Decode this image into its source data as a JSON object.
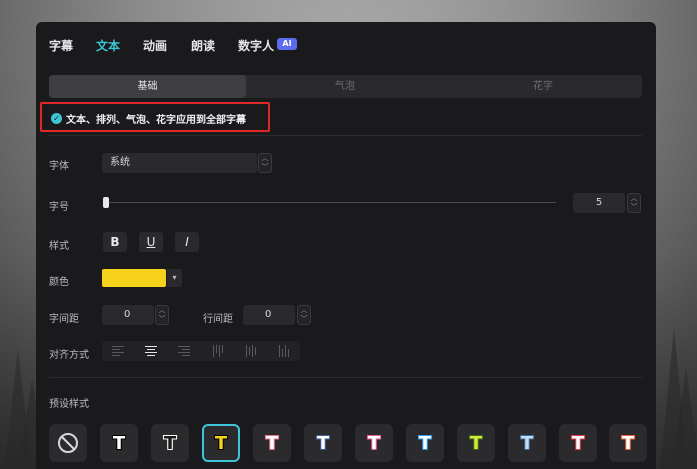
{
  "tabs": [
    {
      "label": "字幕",
      "active": false
    },
    {
      "label": "文本",
      "active": true
    },
    {
      "label": "动画",
      "active": false
    },
    {
      "label": "朗读",
      "active": false
    },
    {
      "label": "数字人",
      "active": false
    }
  ],
  "ai_badge": "AI",
  "subtabs": [
    {
      "label": "基础",
      "active": true
    },
    {
      "label": "气泡",
      "active": false
    },
    {
      "label": "花字",
      "active": false
    }
  ],
  "apply_all": {
    "checked": true,
    "label": "文本、排列、气泡、花字应用到全部字幕"
  },
  "font": {
    "label": "字体",
    "value": "系统"
  },
  "size": {
    "label": "字号",
    "value": "5"
  },
  "style": {
    "label": "样式",
    "bold": "B",
    "underline": "U",
    "italic": "I"
  },
  "color": {
    "label": "颜色",
    "value": "#f6d21b"
  },
  "char_spacing": {
    "label": "字间距",
    "value": "0"
  },
  "line_spacing": {
    "label": "行间距",
    "value": "0"
  },
  "alignment": {
    "label": "对齐方式",
    "selected": "center"
  },
  "presets": {
    "label": "预设样式",
    "items": [
      {
        "name": "none",
        "glyph": "⃠"
      },
      {
        "name": "white",
        "glyph": "T",
        "fill": "#ffffff",
        "stroke": "#000000"
      },
      {
        "name": "outline",
        "glyph": "T",
        "fill": "#1a1a1a",
        "stroke": "#ffffff"
      },
      {
        "name": "yellow",
        "glyph": "T",
        "fill": "#f6d21b",
        "stroke": "#000000",
        "selected": true
      },
      {
        "name": "pink-white",
        "glyph": "T",
        "fill": "#ffffff",
        "stroke": "#e8708a"
      },
      {
        "name": "blue-white",
        "glyph": "T",
        "fill": "#ffffff",
        "stroke": "#3b5a9a"
      },
      {
        "name": "pink",
        "glyph": "T",
        "fill": "#ffffff",
        "stroke": "#e85a9a"
      },
      {
        "name": "cyan",
        "glyph": "T",
        "fill": "#ffffff",
        "stroke": "#2a9ae8"
      },
      {
        "name": "lime",
        "glyph": "T",
        "fill": "#d8e83a",
        "stroke": "#3a6a1a"
      },
      {
        "name": "steel",
        "glyph": "T",
        "fill": "#c8dcef",
        "stroke": "#3a6a9a"
      },
      {
        "name": "red",
        "glyph": "T",
        "fill": "#ffffff",
        "stroke": "#e83a4a"
      },
      {
        "name": "orange",
        "glyph": "T",
        "fill": "#ffffff",
        "stroke": "#e8603a"
      }
    ]
  }
}
